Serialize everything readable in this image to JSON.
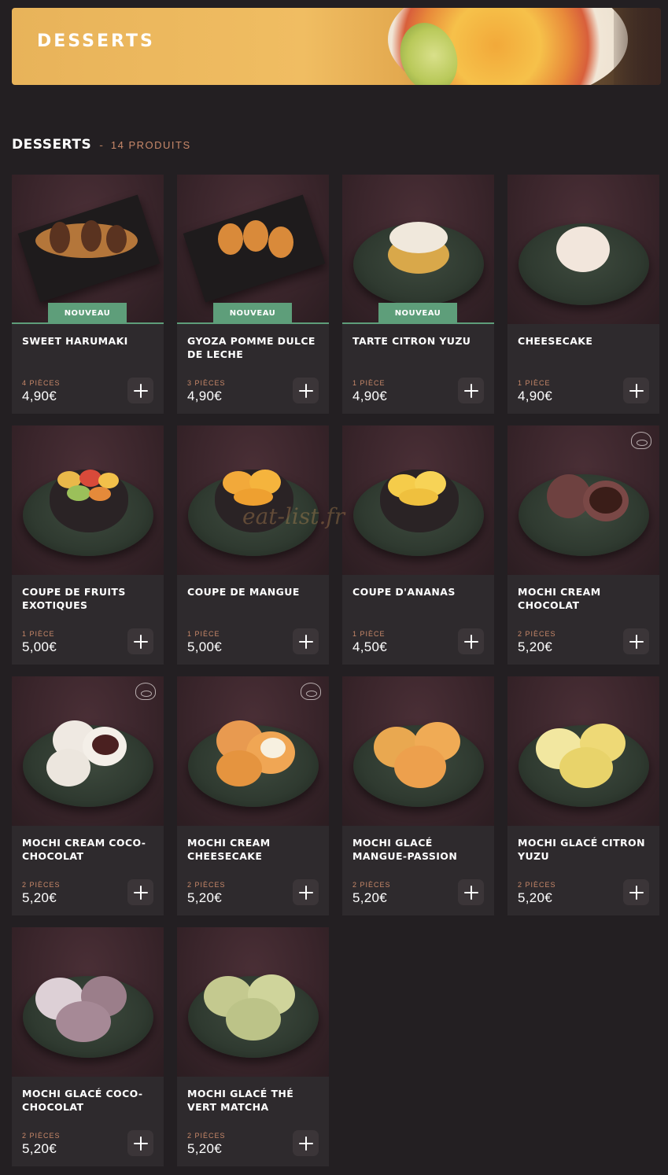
{
  "banner": {
    "title": "DESSERTS"
  },
  "section": {
    "title": "DESSERTS",
    "separator": "-",
    "count": "14 PRODUITS"
  },
  "watermark": "eat-list.fr",
  "colors": {
    "background": "#231f22",
    "card": "#2e2a2d",
    "badge": "#5e9e7a",
    "accent": "#c9896a"
  },
  "products": [
    {
      "name": "SWEET HARUMAKI",
      "qty": "4 PIÈCES",
      "price": "4,90€",
      "badge": "NOUVEAU",
      "visual": "rolls",
      "icon": ""
    },
    {
      "name": "GYOZA POMME DULCE DE LECHE",
      "qty": "3 PIÈCES",
      "price": "4,90€",
      "badge": "NOUVEAU",
      "visual": "gyoza",
      "icon": ""
    },
    {
      "name": "TARTE CITRON YUZU",
      "qty": "1 PIÈCE",
      "price": "4,90€",
      "badge": "NOUVEAU",
      "visual": "tart",
      "icon": ""
    },
    {
      "name": "CHEESECAKE",
      "qty": "1 PIÈCE",
      "price": "4,90€",
      "badge": "",
      "visual": "cheesecake",
      "icon": ""
    },
    {
      "name": "COUPE DE FRUITS EXOTIQUES",
      "qty": "1 PIÈCE",
      "price": "5,00€",
      "badge": "",
      "visual": "fruits",
      "icon": ""
    },
    {
      "name": "COUPE DE MANGUE",
      "qty": "1 PIÈCE",
      "price": "5,00€",
      "badge": "",
      "visual": "mango",
      "icon": ""
    },
    {
      "name": "COUPE D'ANANAS",
      "qty": "1 PIÈCE",
      "price": "4,50€",
      "badge": "",
      "visual": "pineapple",
      "icon": ""
    },
    {
      "name": "MOCHI CREAM CHOCOLAT",
      "qty": "2 PIÈCES",
      "price": "5,20€",
      "badge": "",
      "visual": "mochi-choc",
      "icon": "fait-maison-icon"
    },
    {
      "name": "MOCHI CREAM COCO-CHOCOLAT",
      "qty": "2 PIÈCES",
      "price": "5,20€",
      "badge": "",
      "visual": "mochi-coco",
      "icon": "fait-maison-icon"
    },
    {
      "name": "MOCHI CREAM CHEESECAKE",
      "qty": "2 PIÈCES",
      "price": "5,20€",
      "badge": "",
      "visual": "mochi-orange",
      "icon": "fait-maison-icon"
    },
    {
      "name": "MOCHI GLACÉ MANGUE-PASSION",
      "qty": "2 PIÈCES",
      "price": "5,20€",
      "badge": "",
      "visual": "mochi-mango",
      "icon": ""
    },
    {
      "name": "MOCHI GLACÉ CITRON YUZU",
      "qty": "2 PIÈCES",
      "price": "5,20€",
      "badge": "",
      "visual": "mochi-yuzu",
      "icon": ""
    },
    {
      "name": "MOCHI GLACÉ COCO-CHOCOLAT",
      "qty": "2 PIÈCES",
      "price": "5,20€",
      "badge": "",
      "visual": "mochi-cocochoc",
      "icon": ""
    },
    {
      "name": "MOCHI GLACÉ THÉ VERT MATCHA",
      "qty": "2 PIÈCES",
      "price": "5,20€",
      "badge": "",
      "visual": "mochi-matcha",
      "icon": ""
    }
  ]
}
